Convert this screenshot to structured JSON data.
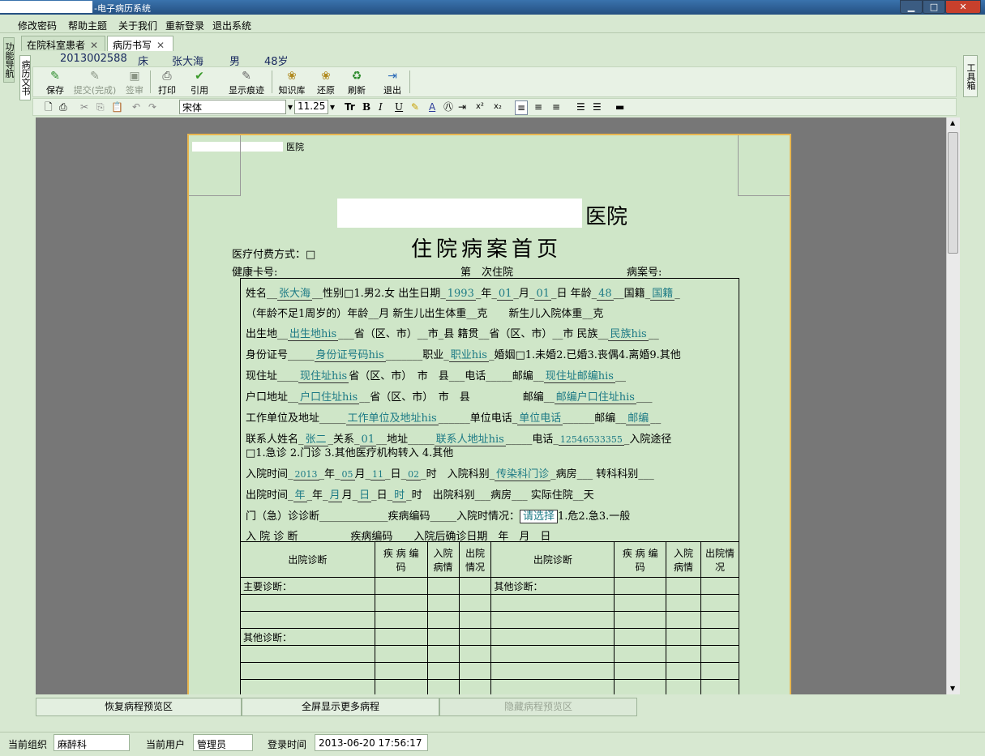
{
  "window": {
    "title": "-电子病历系统",
    "minimize": "▁",
    "maximize": "□",
    "close": "✕"
  },
  "menu": [
    "修改密码",
    "帮助主题",
    "关于我们",
    "重新登录",
    "退出系统"
  ],
  "left_tabs": {
    "nav": "功能导航",
    "doc": "病历文书"
  },
  "right_tab": "工具箱",
  "tabs": [
    {
      "label": "在院科室患者",
      "close": "✕"
    },
    {
      "label": "病历书写",
      "close": "✕"
    }
  ],
  "patient": {
    "id": "2013002588",
    "bed": "床",
    "name": "张大海",
    "sex": "男",
    "age": "48岁"
  },
  "toolbar": [
    {
      "label": "保存",
      "icon": "save-icon",
      "glyph": "✎",
      "enabled": true
    },
    {
      "label": "提交(完成)",
      "icon": "submit-icon",
      "glyph": "✎",
      "enabled": false
    },
    {
      "label": "签审",
      "icon": "sign-icon",
      "glyph": "▣",
      "enabled": false
    },
    {
      "label": "打印",
      "icon": "print-icon",
      "glyph": "⎙",
      "enabled": true
    },
    {
      "label": "引用",
      "icon": "quote-icon",
      "glyph": "✔",
      "enabled": true
    },
    {
      "label": "显示痕迹",
      "icon": "trace-icon",
      "glyph": "✎",
      "enabled": true
    },
    {
      "label": "知识库",
      "icon": "knowledge-icon",
      "glyph": "❀",
      "enabled": true
    },
    {
      "label": "还原",
      "icon": "restore-icon",
      "glyph": "❀",
      "enabled": true
    },
    {
      "label": "刷新",
      "icon": "refresh-icon",
      "glyph": "♻",
      "enabled": true
    },
    {
      "label": "退出",
      "icon": "exit-icon",
      "glyph": "⇥",
      "enabled": true
    }
  ],
  "format": {
    "font": "宋体",
    "size": "11.25"
  },
  "document": {
    "header_hospital": "医院",
    "hospital_suffix": "医院",
    "title": "住院病案首页",
    "pay_method": "医疗付费方式：□",
    "health_card": "健康卡号:",
    "times": "第　次住院",
    "record_no": "病案号:",
    "name": "张大海",
    "birth_year": "1993",
    "birth_month": "01",
    "birth_day": "01",
    "age": "48",
    "nationality": "国籍",
    "birthplace": "出生地his",
    "ethnic": "民族his",
    "idcard": "身份证号码his",
    "occupation": "职业his",
    "address": "现住址his",
    "address_zip": "现住址邮编his",
    "hukou": "户口住址his",
    "hukou_zip": "邮编户口住址his",
    "work_addr": "工作单位及地址his",
    "work_phone": "单位电话",
    "work_zip": "邮编",
    "contact": "张二",
    "relation": "01",
    "contact_addr": "联系人地址his",
    "contact_phone": "12546533355",
    "in_year": "2013",
    "in_month": "05",
    "in_day": "11",
    "in_hour": "02",
    "in_dept": "传染科门诊",
    "out_y": "年",
    "out_m": "月",
    "out_d": "日",
    "out_h": "时",
    "select": "请选择",
    "lines": {
      "l1a": "姓名",
      "l1b": "性别□1.男2.女 出生日期",
      "l1c": "年",
      "l1d": "月",
      "l1e": "日 年龄",
      "l1f": "国籍",
      "l2": "（年龄不足1周岁的）年龄__月 新生儿出生体重__克　　新生儿入院体重__克",
      "l3a": "出生地",
      "l3b": "省（区、市）__市_县 籍贯__省（区、市）__市 民族",
      "l4a": "身份证号",
      "l4b": "职业",
      "l4c": "婚姻□1.未婚2.已婚3.丧偶4.离婚9.其他",
      "l5a": "现住址",
      "l5b": "省（区、市）　市　县___电话_____邮编",
      "l6a": "户口地址",
      "l6b": "省（区、市）　市　县　　　　　邮编",
      "l7a": "工作单位及地址",
      "l7b": "单位电话",
      "l7c": "邮编",
      "l8a": "联系人姓名",
      "l8b": "关系",
      "l8c": "地址",
      "l8d": "电话",
      "l8e": "入院途径",
      "l9": "□1.急诊 2.门诊 3.其他医疗机构转入 4.其他",
      "l10a": "入院时间",
      "l10b": "年",
      "l10c": "月",
      "l10d": "日",
      "l10e": "时　入院科别",
      "l10f": "病房___ 转科科别___",
      "l11a": "出院时间",
      "l11b": "时　出院科别___病房___ 实际住院__天",
      "l12a": "门（急）诊诊断_____________疾病编码_____入院时情况：",
      "l12b": "1.危2.急3.一般",
      "l13": "入 院 诊 断　　　　　疾病编码　　入院后确诊日期　年　月　日"
    },
    "table": {
      "h1": "出院诊断",
      "h2": "疾 病 编 码",
      "h3": "入院病情",
      "h4": "出院情况",
      "h5": "出院诊断",
      "h6": "疾 病 编 码",
      "h7": "入院病情",
      "h8": "出院情况",
      "main": "主要诊断：",
      "other1": "其他诊断：",
      "other2": "其他诊断："
    }
  },
  "bottom": {
    "restore": "恢复病程预览区",
    "fullscreen": "全屏显示更多病程",
    "hide": "隐藏病程预览区"
  },
  "status": {
    "org_label": "当前组织",
    "org": "麻醉科",
    "user_label": "当前用户",
    "user": "管理员",
    "login_label": "登录时间",
    "login": "2013-06-20 17:56:17"
  }
}
